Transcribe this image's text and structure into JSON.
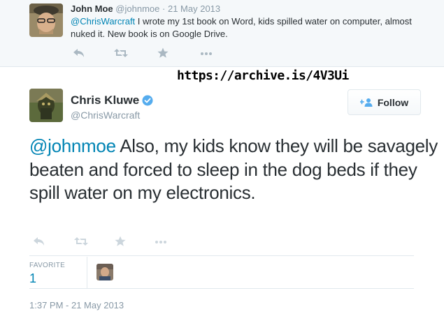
{
  "reply_tweet": {
    "name": "John Moe",
    "handle": "@johnmoe",
    "separator": "·",
    "date": "21 May 2013",
    "mention": "@ChrisWarcraft",
    "text": " I wrote my 1st book on Word, kids spilled water on computer, almost nuked it. New book is on Google Drive."
  },
  "overlay": {
    "archive_url": "https://archive.is/4V3Ui"
  },
  "main_tweet": {
    "name": "Chris Kluwe",
    "handle": "@ChrisWarcraft",
    "verified": true,
    "mention": "@johnmoe",
    "text": " Also, my kids know they will be savagely beaten and forced to sleep in the dog beds if they spill water on my electronics.",
    "favorite_label": "FAVORITE",
    "favorite_count": "1",
    "timestamp": "1:37 PM - 21 May 2013"
  },
  "follow_button": {
    "label": "Follow"
  },
  "icons": {
    "reply": "reply-icon",
    "retweet": "retweet-icon",
    "favorite": "star-icon",
    "more": "more-icon",
    "verified": "verified-badge-icon",
    "follow": "follow-person-icon"
  },
  "colors": {
    "link": "#0084b4",
    "muted": "#8899a6",
    "text": "#292f33",
    "verified": "#55acee",
    "reply_bg": "#f5f8fa",
    "icon": "#aab8c2"
  }
}
